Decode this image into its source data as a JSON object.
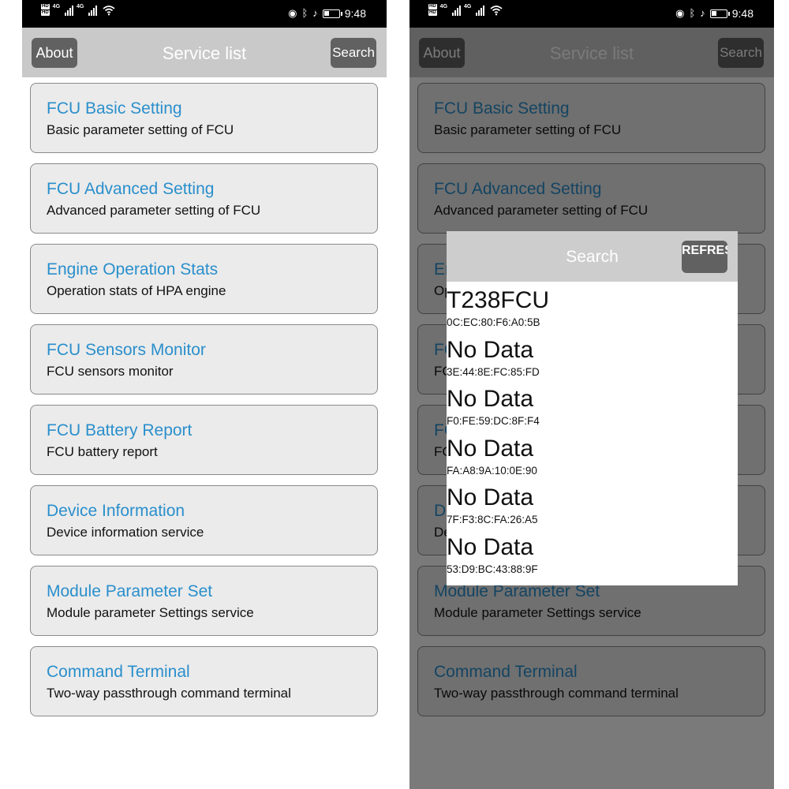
{
  "status_bar": {
    "hd1": "HD",
    "hd2": "HD",
    "net1": "4G",
    "net2": "4G",
    "time": "9:48",
    "icons": [
      "eye-icon",
      "bluetooth-icon",
      "bell-off-icon",
      "battery-icon"
    ]
  },
  "header": {
    "about_label": "About",
    "title": "Service list",
    "search_label": "Search"
  },
  "services": [
    {
      "title": "FCU Basic Setting",
      "desc": "Basic parameter setting of FCU"
    },
    {
      "title": "FCU Advanced Setting",
      "desc": "Advanced parameter setting of FCU"
    },
    {
      "title": "Engine Operation Stats",
      "desc": "Operation stats of HPA engine"
    },
    {
      "title": "FCU Sensors Monitor",
      "desc": "FCU sensors monitor"
    },
    {
      "title": "FCU Battery Report",
      "desc": "FCU battery report"
    },
    {
      "title": "Device Information",
      "desc": "Device information service"
    },
    {
      "title": "Module Parameter Set",
      "desc": "Module parameter Settings service"
    },
    {
      "title": "Command Terminal",
      "desc": "Two-way passthrough command terminal"
    }
  ],
  "search_dialog": {
    "title": "Search",
    "refresh_label": "REFRESH",
    "devices": [
      {
        "name": "T238FCU",
        "mac": "0C:EC:80:F6:A0:5B"
      },
      {
        "name": "No Data",
        "mac": "3E:44:8E:FC:85:FD"
      },
      {
        "name": "No Data",
        "mac": "F0:FE:59:DC:8F:F4"
      },
      {
        "name": "No Data",
        "mac": "FA:A8:9A:10:0E:90"
      },
      {
        "name": "No Data",
        "mac": "7F:F3:8C:FA:26:A5"
      },
      {
        "name": "No Data",
        "mac": "53:D9:BC:43:88:9F"
      }
    ]
  },
  "colors": {
    "header_bg": "#c9c9c9",
    "button_bg": "#616161",
    "service_title": "#2a8fcc",
    "card_bg": "#ebebeb"
  }
}
